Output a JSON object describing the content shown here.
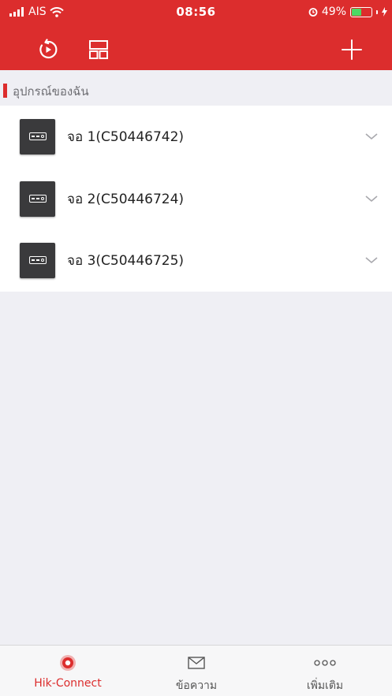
{
  "status_bar": {
    "carrier": "AIS",
    "time": "08:56",
    "battery_percent": "49%",
    "battery_level": 0.49
  },
  "toolbar": {
    "left_icons": [
      "playback-icon",
      "layout-icon"
    ],
    "right_icon": "add-icon"
  },
  "section": {
    "title": "อุปกรณ์ของฉัน"
  },
  "devices": [
    {
      "name": "จอ 1(C50446742)"
    },
    {
      "name": "จอ 2(C50446724)"
    },
    {
      "name": "จอ 3(C50446725)"
    }
  ],
  "tabs": [
    {
      "label": "Hik-Connect",
      "icon": "hik-connect-icon",
      "active": true
    },
    {
      "label": "ข้อความ",
      "icon": "message-icon",
      "active": false
    },
    {
      "label": "เพิ่มเติม",
      "icon": "more-icon",
      "active": false
    }
  ],
  "colors": {
    "brand_red": "#dc2d2d",
    "background": "#efeff4",
    "battery_green": "#4cd964"
  }
}
